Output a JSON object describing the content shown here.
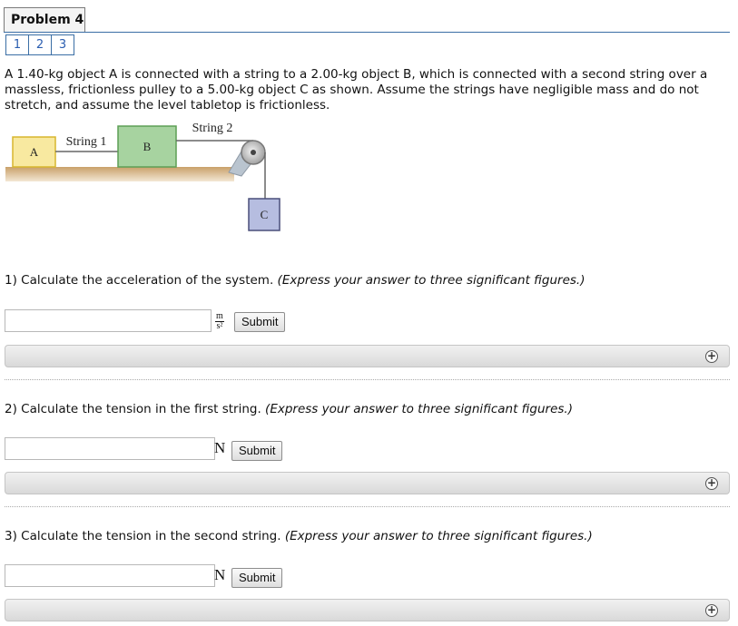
{
  "header": {
    "title": "Problem 4",
    "pages": [
      "1",
      "2",
      "3"
    ]
  },
  "statement": "A 1.40-kg object A is connected with a string to a 2.00-kg object B, which is connected with a second string over a massless, frictionless pulley to a 5.00-kg object C as shown. Assume the strings have negligible mass and do not stretch, and assume the level tabletop is frictionless.",
  "figure": {
    "label_a": "A",
    "label_b": "B",
    "label_c": "C",
    "string1": "String 1",
    "string2": "String 2"
  },
  "questions": [
    {
      "text": "1) Calculate the acceleration of the system.",
      "hint": "(Express your answer to three significant figures.)",
      "unit_num": "m",
      "unit_den": "s²",
      "submit": "Submit",
      "value": ""
    },
    {
      "text": "2) Calculate the tension in the first string.",
      "hint": "(Express your answer to three significant figures.)",
      "unit": "N",
      "submit": "Submit",
      "value": ""
    },
    {
      "text": "3) Calculate the tension in the second string.",
      "hint": "(Express your answer to three significant figures.)",
      "unit": "N",
      "submit": "Submit",
      "value": ""
    }
  ],
  "icons": {
    "expand": "plus-circle-icon"
  }
}
